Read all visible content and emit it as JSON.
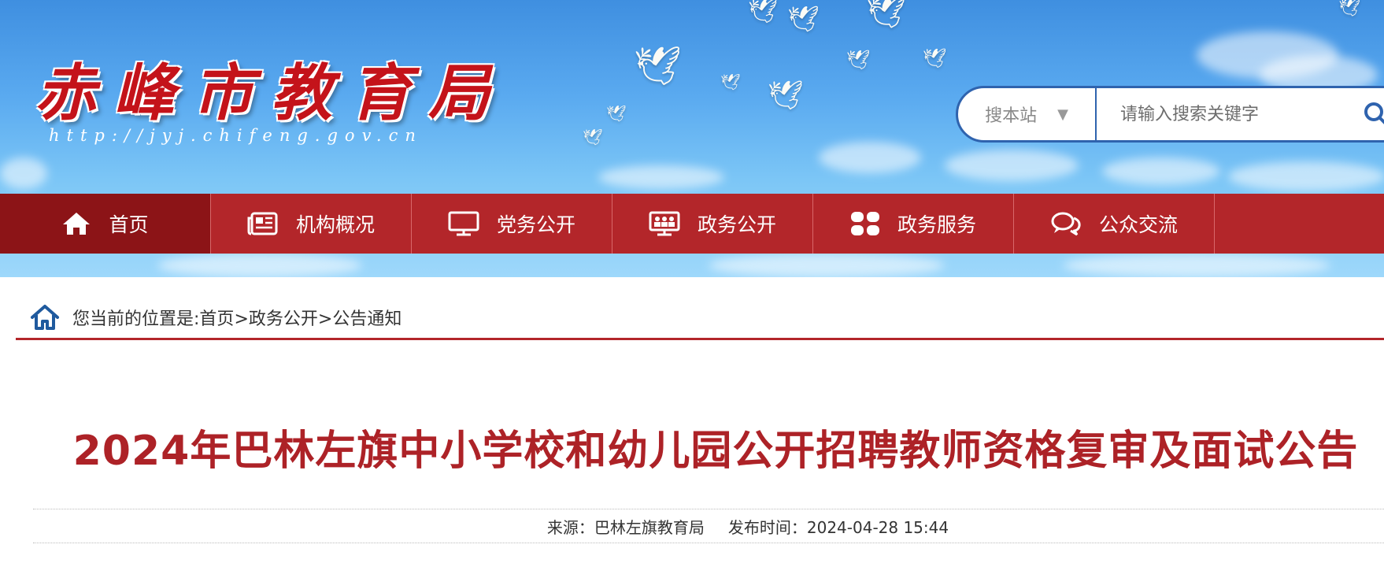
{
  "header": {
    "site_title": "赤峰市教育局",
    "site_url": "http://jyj.chifeng.gov.cn"
  },
  "search": {
    "scope_label": "搜本站",
    "placeholder": "请输入搜索关键字"
  },
  "nav": {
    "items": [
      {
        "label": "首页",
        "icon": "home-icon"
      },
      {
        "label": "机构概况",
        "icon": "newspaper-icon"
      },
      {
        "label": "党务公开",
        "icon": "monitor-icon"
      },
      {
        "label": "政务公开",
        "icon": "meeting-icon"
      },
      {
        "label": "政务服务",
        "icon": "grid-icon"
      },
      {
        "label": "公众交流",
        "icon": "chat-icon"
      }
    ]
  },
  "breadcrumb": {
    "prefix": "您当前的位置是:",
    "items": [
      "首页",
      "政务公开",
      "公告通知"
    ],
    "separator": ">"
  },
  "article": {
    "title": "2024年巴林左旗中小学校和幼儿园公开招聘教师资格复审及面试公告",
    "source_label": "来源：巴林左旗教育局",
    "date_label": "发布时间：2024-04-28 15:44"
  },
  "colors": {
    "brand_red": "#b3262a",
    "nav_active": "#8c1417",
    "search_border": "#2f63ae"
  }
}
